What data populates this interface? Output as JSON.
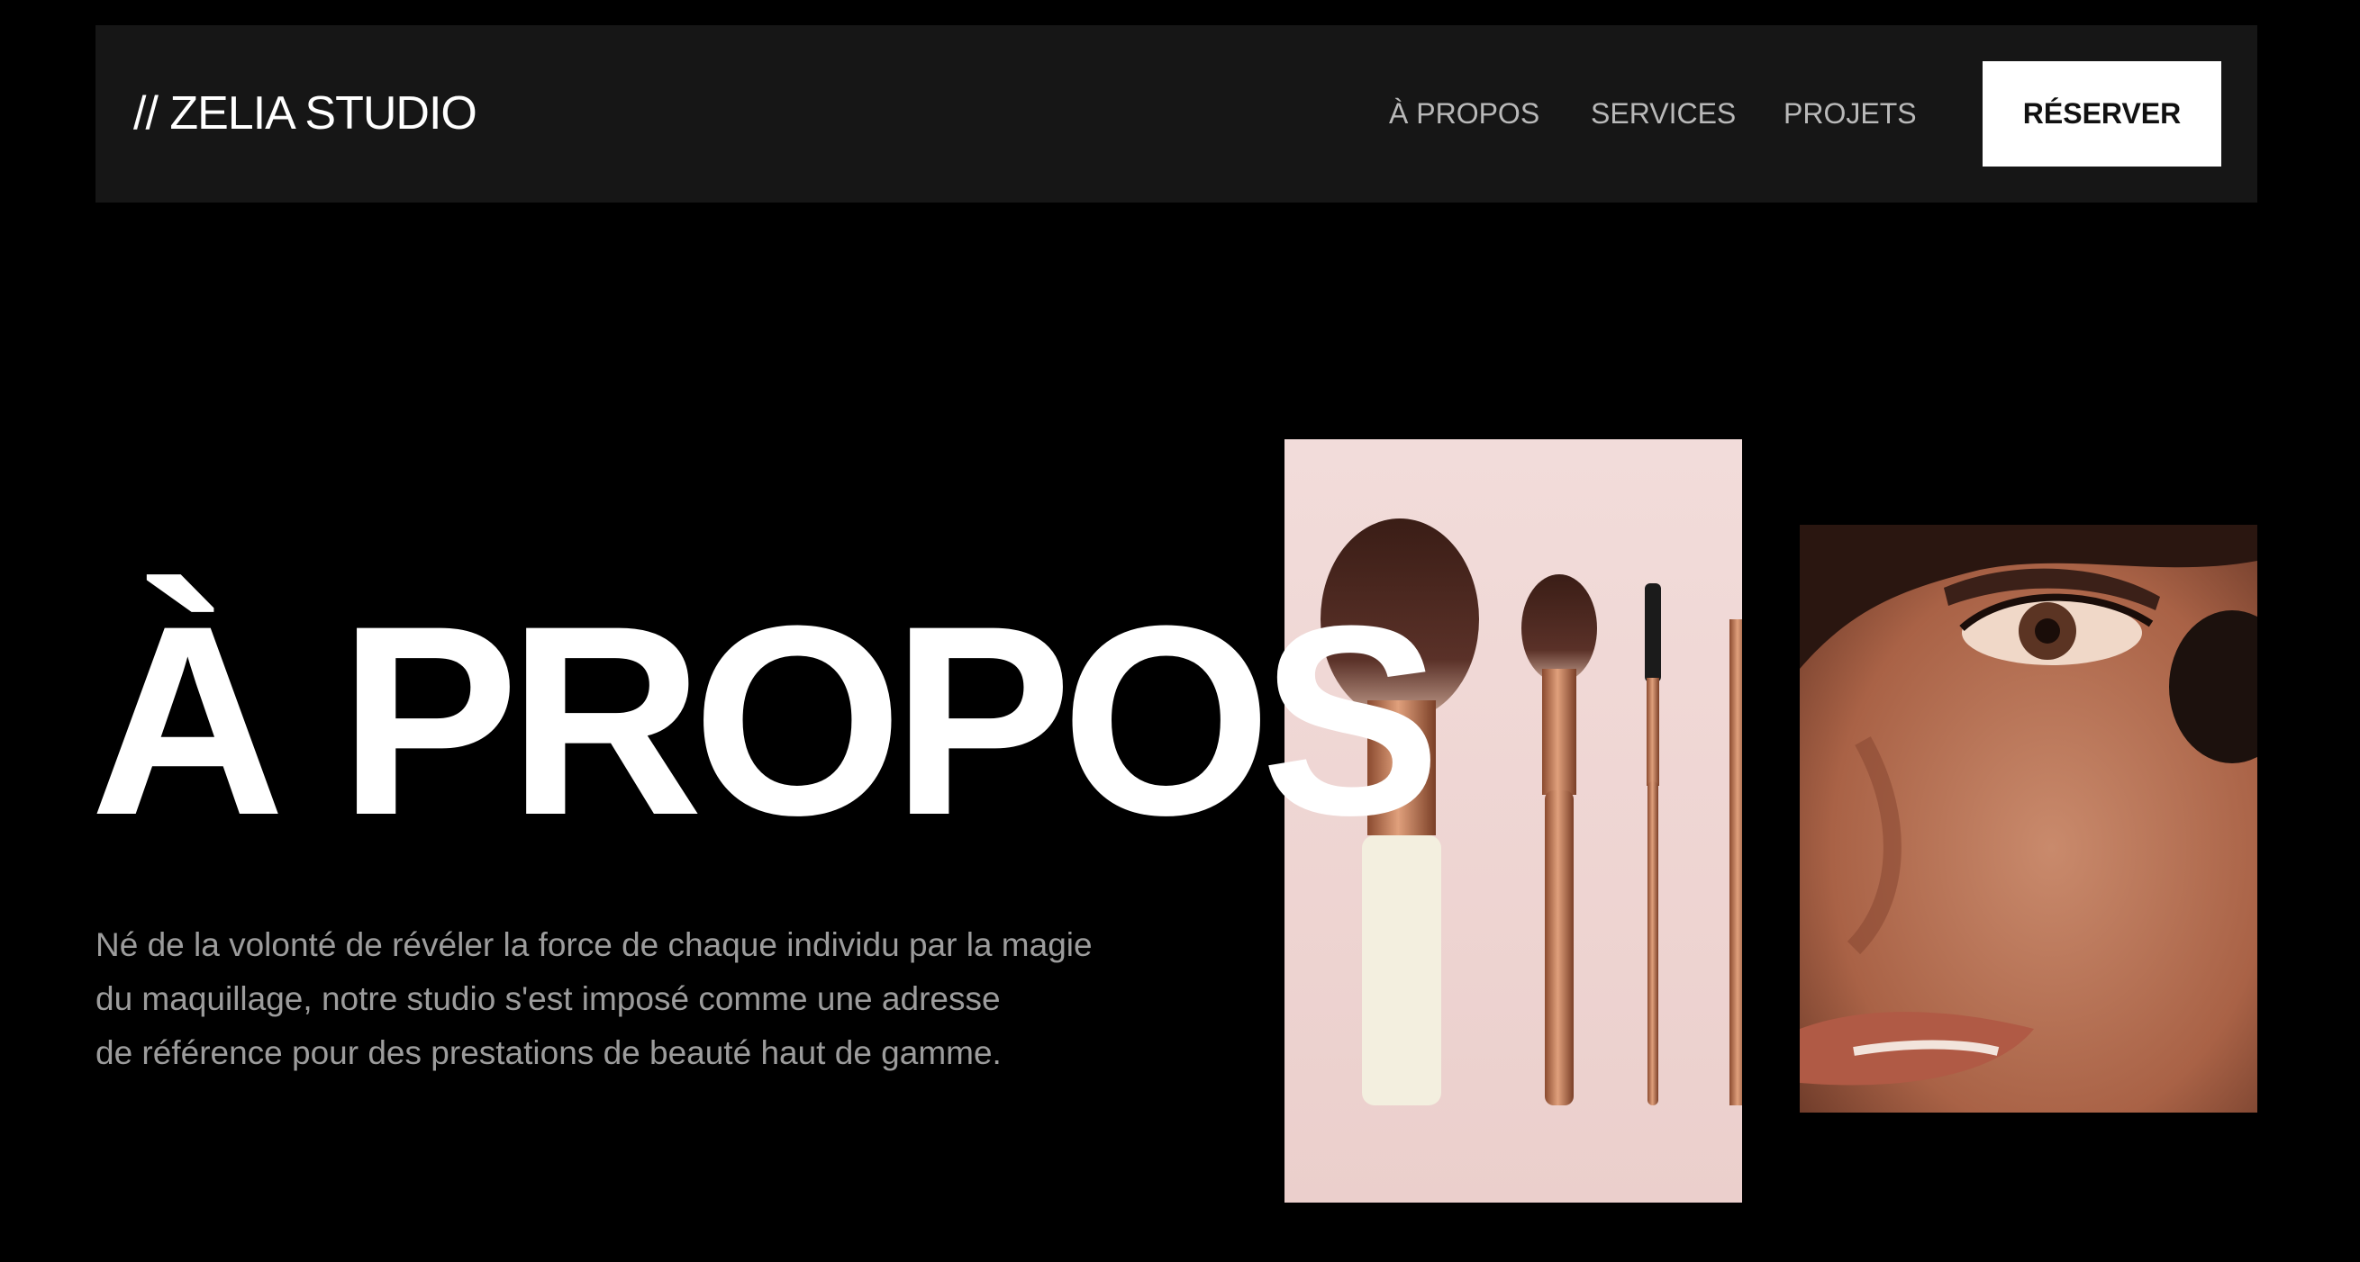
{
  "header": {
    "logo": "// ZELIA STUDIO",
    "nav": [
      "À PROPOS",
      "SERVICES",
      "PROJETS"
    ],
    "cta_label": "RÉSERVER"
  },
  "hero": {
    "title": "À PROPOS",
    "paragraph_lines": [
      "Né de la volonté de révéler la force de chaque individu par la magie",
      "du maquillage, notre studio s'est imposé comme une adresse",
      "de référence pour des prestations de beauté haut de gamme."
    ]
  },
  "images": {
    "brushes": "makeup-brushes-photo",
    "portrait": "face-makeup-closeup-photo"
  },
  "colors": {
    "background": "#000000",
    "header_bg": "#161616",
    "text_primary": "#ffffff",
    "text_muted": "#9c9c9c",
    "nav_text": "#b9b9b9",
    "button_bg": "#ffffff",
    "button_text": "#111111",
    "brushes_bg": "#f1d8d6",
    "copper": "#b8714f"
  }
}
